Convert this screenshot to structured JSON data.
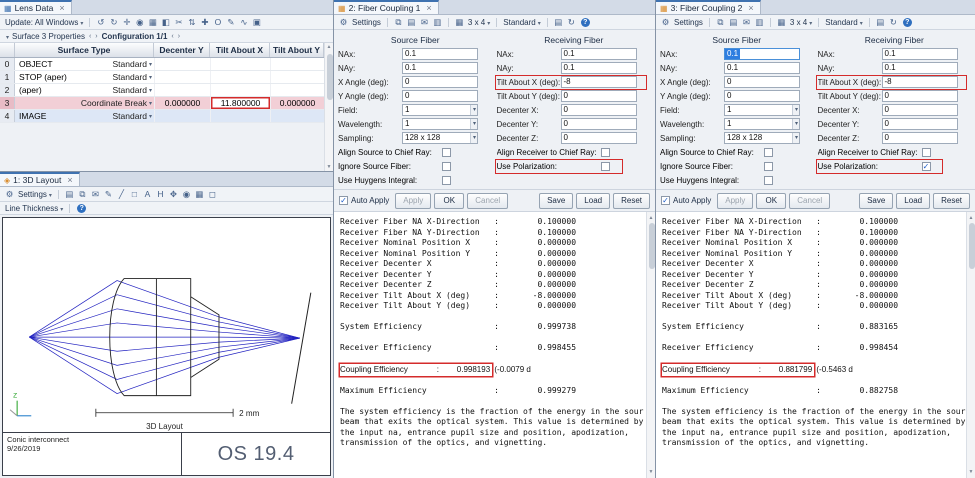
{
  "icons": {
    "close": "×",
    "caret": "▾",
    "left": "‹",
    "right": "›",
    "up": "▲",
    "down": "▼",
    "gear": "⚙",
    "help": "?",
    "lens_tab": "▦",
    "layout_tab": "◈",
    "fiber_tab": "▦",
    "grid_glyph": "▦"
  },
  "lens": {
    "tab": "Lens Data",
    "update_label": "Update: All Windows",
    "toolbar_icons": [
      "↺",
      "↻",
      "✛",
      "◉",
      "▦",
      "◧",
      "✂",
      "⇅",
      "✚",
      "O",
      "✎",
      "∿",
      "▣"
    ],
    "surface_props": "Surface  3 Properties",
    "configuration": "Configuration 1/1",
    "columns": [
      "Surface Type",
      "Decenter Y",
      "Tilt About X",
      "Tilt About Y"
    ],
    "rows": [
      {
        "num": "0",
        "name": "OBJECT",
        "type": "Standard",
        "dec": "",
        "tx": "",
        "ty": ""
      },
      {
        "num": "1",
        "name": "STOP (aper)",
        "type": "Standard",
        "dec": "",
        "tx": "",
        "ty": ""
      },
      {
        "num": "2",
        "name": "(aper)",
        "type": "Standard",
        "dec": "",
        "tx": "",
        "ty": ""
      },
      {
        "num": "3",
        "name": "",
        "type": "Coordinate Break",
        "dec": "0.000000",
        "tx": "11.800000",
        "ty": "0.000000",
        "selected": true,
        "annotate": true
      },
      {
        "num": "4",
        "name": "IMAGE",
        "type": "Standard",
        "dec": "",
        "tx": "",
        "ty": "",
        "image": true
      }
    ]
  },
  "layout3d": {
    "tab": "1: 3D Layout",
    "settings_label": "Settings",
    "toolbar_icons": [
      "▤",
      "⧉",
      "✉",
      "✎",
      "╱",
      "□",
      "A",
      "H",
      "✥",
      "◉",
      "▦",
      "◻"
    ],
    "line_thickness_label": "Line Thickness",
    "scale_label": "2 mm",
    "caption": "3D Layout",
    "axis_z": "Z",
    "footer_title": "Conic interconnect",
    "footer_date": "9/26/2019",
    "logo": "OS 19.4"
  },
  "ftb": {
    "settings": "Settings",
    "icons1": [
      "⧉",
      "▤",
      "✉",
      "▥"
    ],
    "grid": "3 x 4",
    "style": "Standard",
    "icons2": [
      "▤",
      "↻"
    ]
  },
  "buttons": {
    "auto_apply": "Auto Apply",
    "apply": "Apply",
    "ok": "OK",
    "cancel": "Cancel",
    "save": "Save",
    "load": "Load",
    "reset": "Reset"
  },
  "panels": [
    {
      "tab": "2: Fiber Coupling 1",
      "source_title": "Source Fiber",
      "receiving_title": "Receiving Fiber",
      "source_fields": [
        {
          "label": "NAx:",
          "value": "0.1"
        },
        {
          "label": "NAy:",
          "value": "0.1"
        },
        {
          "label": "X Angle (deg):",
          "value": "0"
        },
        {
          "label": "Y Angle (deg):",
          "value": "0"
        },
        {
          "label": "Field:",
          "value": "1",
          "select": true
        },
        {
          "label": "Wavelength:",
          "value": "1",
          "select": true
        },
        {
          "label": "Sampling:",
          "value": "128 x 128",
          "select": true
        }
      ],
      "source_checks": [
        {
          "label": "Align Source to Chief Ray:"
        },
        {
          "label": "Ignore Source Fiber:"
        },
        {
          "label": "Use Huygens Integral:"
        }
      ],
      "recv_fields": [
        {
          "label": "NAx:",
          "value": "0.1"
        },
        {
          "label": "NAy:",
          "value": "0.1"
        },
        {
          "label": "Tilt About X (deg):",
          "value": "-8",
          "highlight": true
        },
        {
          "label": "Tilt About Y (deg):",
          "value": "0"
        },
        {
          "label": "Decenter X:",
          "value": "0"
        },
        {
          "label": "Decenter Y:",
          "value": "0"
        },
        {
          "label": "Decenter Z:",
          "value": "0"
        }
      ],
      "recv_checks": [
        {
          "label": "Align Receiver to Chief Ray:"
        },
        {
          "label": "Use Polarization:",
          "highlight": true
        }
      ],
      "output_pre": "Receiver Fiber NA X-Direction   :        0.100000\nReceiver Fiber NA Y-Direction   :        0.100000\nReceiver Nominal Position X     :        0.000000\nReceiver Nominal Position Y     :        0.000000\nReceiver Decenter X             :        0.000000\nReceiver Decenter Y             :        0.000000\nReceiver Decenter Z             :        0.000000\nReceiver Tilt About X (deg)     :       -8.000000\nReceiver Tilt About Y (deg)     :        0.000000\n\nSystem Efficiency               :        0.999738\n\nReceiver Efficiency             :        0.998455",
      "coupling_label": "Coupling Efficiency             :        0.998193",
      "coupling_extra": " (-0.0079 d",
      "output_post": "Maximum Efficiency              :        0.999279",
      "description": "The system efficiency is the fraction of the energy in the sour\nbeam that exits the optical system. This value is determined by\nthe input na, entrance pupil size and position, apodization,\ntransmission of the optics, and vignetting."
    },
    {
      "tab": "3: Fiber Coupling 2",
      "source_title": "Source Fiber",
      "receiving_title": "Receiving Fiber",
      "source_fields": [
        {
          "label": "NAx:",
          "value": "0.1",
          "sel": true
        },
        {
          "label": "NAy:",
          "value": "0.1"
        },
        {
          "label": "X Angle (deg):",
          "value": "0"
        },
        {
          "label": "Y Angle (deg):",
          "value": "0"
        },
        {
          "label": "Field:",
          "value": "1",
          "select": true
        },
        {
          "label": "Wavelength:",
          "value": "1",
          "select": true
        },
        {
          "label": "Sampling:",
          "value": "128 x 128",
          "select": true
        }
      ],
      "source_checks": [
        {
          "label": "Align Source to Chief Ray:"
        },
        {
          "label": "Ignore Source Fiber:"
        },
        {
          "label": "Use Huygens Integral:"
        }
      ],
      "recv_fields": [
        {
          "label": "NAx:",
          "value": "0.1"
        },
        {
          "label": "NAy:",
          "value": "0.1"
        },
        {
          "label": "Tilt About X (deg):",
          "value": "-8",
          "highlight": true
        },
        {
          "label": "Tilt About Y (deg):",
          "value": "0"
        },
        {
          "label": "Decenter X:",
          "value": "0"
        },
        {
          "label": "Decenter Y:",
          "value": "0"
        },
        {
          "label": "Decenter Z:",
          "value": "0"
        }
      ],
      "recv_checks": [
        {
          "label": "Align Receiver to Chief Ray:"
        },
        {
          "label": "Use Polarization:",
          "highlight": true,
          "checked": true
        }
      ],
      "output_pre": "Receiver Fiber NA X-Direction   :        0.100000\nReceiver Fiber NA Y-Direction   :        0.100000\nReceiver Nominal Position X     :        0.000000\nReceiver Nominal Position Y     :        0.000000\nReceiver Decenter X             :        0.000000\nReceiver Decenter Y             :        0.000000\nReceiver Decenter Z             :        0.000000\nReceiver Tilt About X (deg)     :       -8.000000\nReceiver Tilt About Y (deg)     :        0.000000\n\nSystem Efficiency               :        0.883165\n\nReceiver Efficiency             :        0.998454",
      "coupling_label": "Coupling Efficiency             :        0.881799",
      "coupling_extra": " (-0.5463 d",
      "output_post": "Maximum Efficiency              :        0.882758",
      "description": "The system efficiency is the fraction of the energy in the sour\nbeam that exits the optical system. This value is determined by\nthe input na, entrance pupil size and position, apodization,\ntransmission of the optics, and vignetting."
    }
  ]
}
